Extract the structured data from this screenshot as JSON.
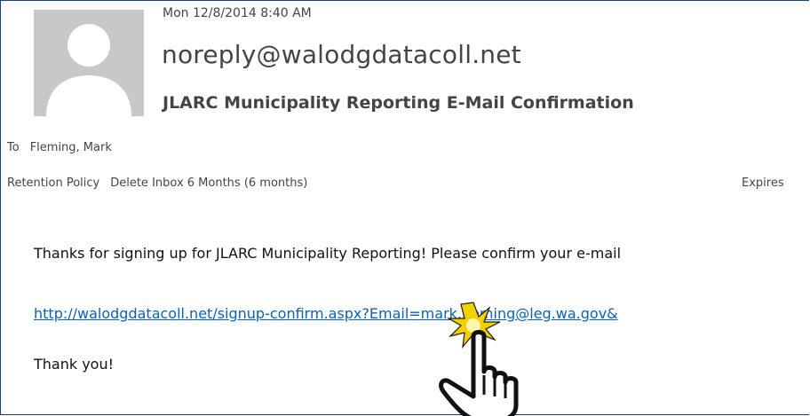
{
  "message": {
    "date": "Mon 12/8/2014 8:40 AM",
    "sender": "noreply@walodgdatacoll.net",
    "subject": "JLARC Municipality Reporting E-Mail Confirmation",
    "to_label": "To",
    "to_value": "Fleming, Mark",
    "retention_label": "Retention Policy",
    "retention_value": "Delete Inbox 6 Months (6 months)",
    "expires_label": "Expires"
  },
  "body": {
    "line1": "Thanks for signing up for JLARC Municipality Reporting! Please confirm your e-mail",
    "link": "http://walodgdatacoll.net/signup-confirm.aspx?Email=mark.fleming@leg.wa.gov&",
    "thanks": "Thank you!"
  },
  "icons": {
    "avatar": "default-contact-silhouette-icon",
    "pointer": "hand-pointer-click-icon"
  },
  "colors": {
    "link": "#0563c1",
    "text": "#444444",
    "border": "#1f3c86",
    "click_burst": "#f5d000"
  }
}
